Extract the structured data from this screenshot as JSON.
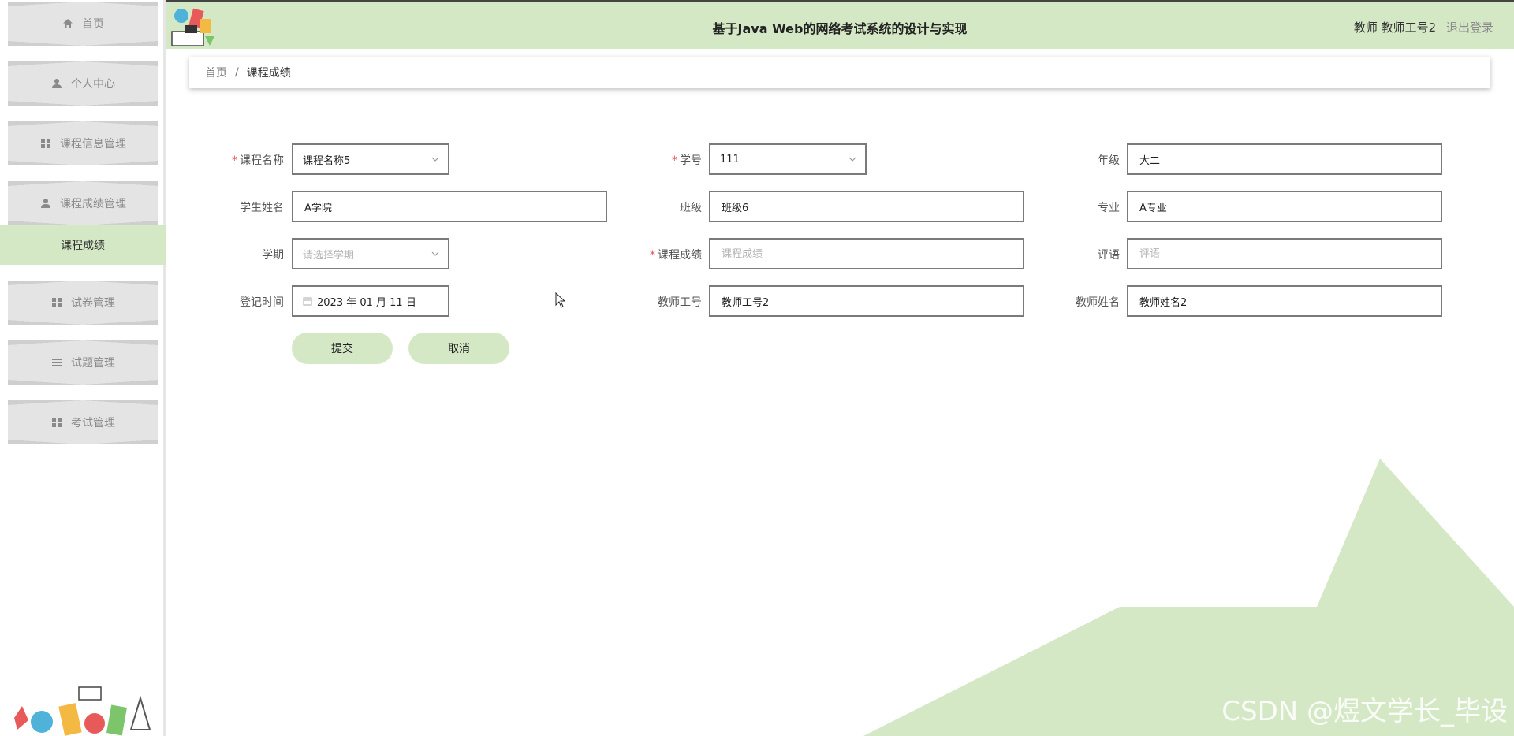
{
  "header": {
    "title": "基于Java Web的网络考试系统的设计与实现",
    "user": "教师 教师工号2",
    "logout": "退出登录"
  },
  "sidebar": {
    "items": [
      {
        "label": "首页",
        "icon": "home-icon"
      },
      {
        "label": "个人中心",
        "icon": "user-icon"
      },
      {
        "label": "课程信息管理",
        "icon": "grid-icon"
      },
      {
        "label": "课程成绩管理",
        "icon": "user-icon"
      },
      {
        "label": "试卷管理",
        "icon": "grid-icon"
      },
      {
        "label": "试题管理",
        "icon": "list-icon"
      },
      {
        "label": "考试管理",
        "icon": "grid-icon"
      }
    ],
    "active_submenu": "课程成绩"
  },
  "breadcrumb": {
    "home": "首页",
    "separator": "/",
    "current": "课程成绩"
  },
  "form": {
    "course_name": {
      "label": "课程名称",
      "value": "课程名称5"
    },
    "student_no": {
      "label": "学号",
      "value": "111"
    },
    "grade_year": {
      "label": "年级",
      "value": "大二"
    },
    "student_name": {
      "label": "学生姓名",
      "value": "A学院"
    },
    "class": {
      "label": "班级",
      "value": "班级6"
    },
    "major": {
      "label": "专业",
      "value": "A专业"
    },
    "semester": {
      "label": "学期",
      "placeholder": "请选择学期"
    },
    "course_score": {
      "label": "课程成绩",
      "placeholder": "课程成绩"
    },
    "comment": {
      "label": "评语",
      "placeholder": "评语"
    },
    "register_time": {
      "label": "登记时间",
      "value": "2023 年 01 月 11 日"
    },
    "teacher_no": {
      "label": "教师工号",
      "value": "教师工号2"
    },
    "teacher_name": {
      "label": "教师姓名",
      "value": "教师姓名2"
    },
    "required_mark": "*",
    "submit": "提交",
    "cancel": "取消"
  },
  "watermark": "CSDN @煜文学长_毕设",
  "colors": {
    "accent_green": "#d4e8c5",
    "required_red": "#e85050"
  }
}
